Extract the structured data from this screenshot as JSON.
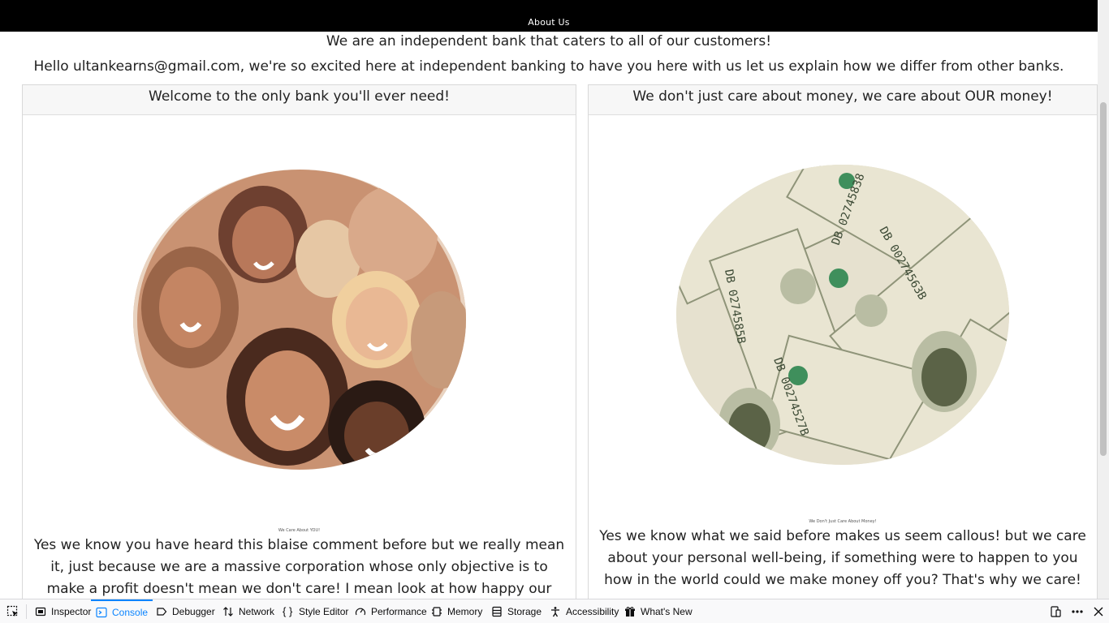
{
  "nav": {
    "about_label": "About Us"
  },
  "intro": {
    "line1": "We are an independent bank that caters to all of our customers!",
    "line2": "Hello ultankearns@gmail.com, we're so excited here at independent banking to have you here with us let us explain how we differ from other banks."
  },
  "cards": [
    {
      "header": "Welcome to the only bank you'll ever need!",
      "caption": "We Care About YOU!",
      "body": "Yes we know you have heard this blaise comment before but we really mean it, just because we are a massive corporation whose only objective is to make a profit doesn't mean we don't care! I mean look at how happy our customers are! You too"
    },
    {
      "header": "We don't just care about money, we care about OUR money!",
      "caption": "We Don't Just Care About Money!",
      "body": "Yes we know what we said before makes us seem callous! but we care about your personal well-being, if something were to happen to you how in the world could we make money off you? That's why we care!"
    }
  ],
  "devtools": {
    "tabs": [
      "Inspector",
      "Console",
      "Debugger",
      "Network",
      "Style Editor",
      "Performance",
      "Memory",
      "Storage",
      "Accessibility",
      "What's New"
    ],
    "active_tab": "Console",
    "accent_color": "#0a84ff"
  }
}
